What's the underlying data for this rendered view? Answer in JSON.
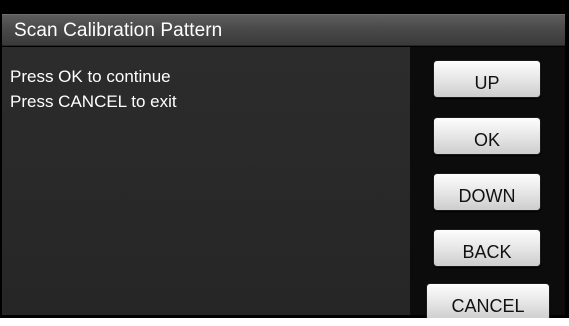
{
  "title": "Scan Calibration Pattern",
  "messages": [
    "Press OK to continue",
    "Press CANCEL to exit"
  ],
  "buttons": {
    "up": "UP",
    "ok": "OK",
    "down": "DOWN",
    "back": "BACK",
    "cancel": "CANCEL"
  },
  "colors": {
    "background": "#000000",
    "titlebar": "#4a4a4a",
    "content_panel": "#2a2a2a",
    "button_face": "#e9e9e9",
    "text": "#ffffff"
  }
}
